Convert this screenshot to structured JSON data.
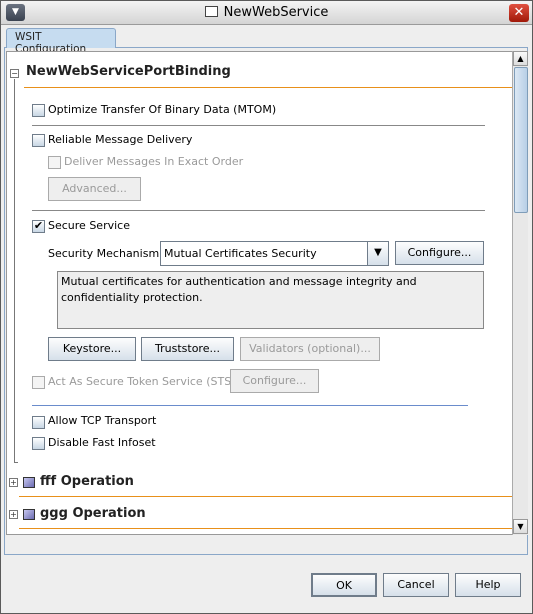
{
  "window": {
    "title": "NewWebService"
  },
  "tab": {
    "label": "WSIT Configuration"
  },
  "binding": {
    "title": "NewWebServicePortBinding",
    "mtom": {
      "label": "Optimize Transfer Of Binary Data (MTOM)",
      "checked": false
    },
    "reliable": {
      "label": "Reliable Message Delivery",
      "checked": false
    },
    "ordered": {
      "label": "Deliver Messages In Exact Order",
      "checked": false,
      "enabled": false
    },
    "advanced_label": "Advanced...",
    "secure": {
      "label": "Secure Service",
      "checked": true
    },
    "mechanism_label": "Security Mechanism:",
    "mechanism_value": "Mutual Certificates Security",
    "configure_label": "Configure...",
    "description": "Mutual certificates for authentication and message integrity and confidentiality protection.",
    "keystore_label": "Keystore...",
    "truststore_label": "Truststore...",
    "validators_label": "Validators (optional)...",
    "sts": {
      "label": "Act As Secure Token Service (STS)",
      "checked": false,
      "enabled": false
    },
    "sts_configure_label": "Configure...",
    "tcp": {
      "label": "Allow TCP Transport",
      "checked": false
    },
    "fastinfoset": {
      "label": "Disable Fast Infoset",
      "checked": false
    }
  },
  "operations": [
    {
      "label": "fff Operation"
    },
    {
      "label": "ggg Operation"
    }
  ],
  "footer": {
    "ok": "OK",
    "cancel": "Cancel",
    "help": "Help"
  },
  "colors": {
    "accent_orange": "#e8901a",
    "separator_blue": "#6a8ccc"
  }
}
